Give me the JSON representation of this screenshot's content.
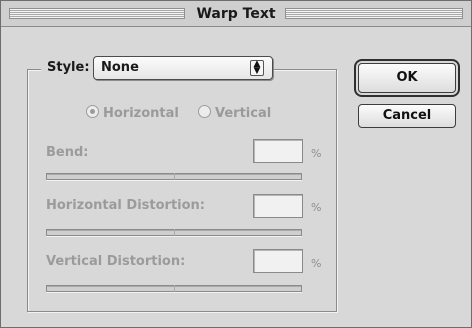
{
  "dialog": {
    "title": "Warp Text"
  },
  "style": {
    "label": "Style:",
    "selected": "None"
  },
  "orientation": {
    "horizontal_label": "Horizontal",
    "vertical_label": "Vertical",
    "selected": "Horizontal"
  },
  "params": {
    "bend_label": "Bend:",
    "bend_value": "",
    "bend_unit": "%",
    "horizontal_distortion_label": "Horizontal Distortion:",
    "horizontal_distortion_value": "",
    "horizontal_distortion_unit": "%",
    "vertical_distortion_label": "Vertical Distortion:",
    "vertical_distortion_value": "",
    "vertical_distortion_unit": "%"
  },
  "buttons": {
    "ok_label": "OK",
    "cancel_label": "Cancel"
  }
}
